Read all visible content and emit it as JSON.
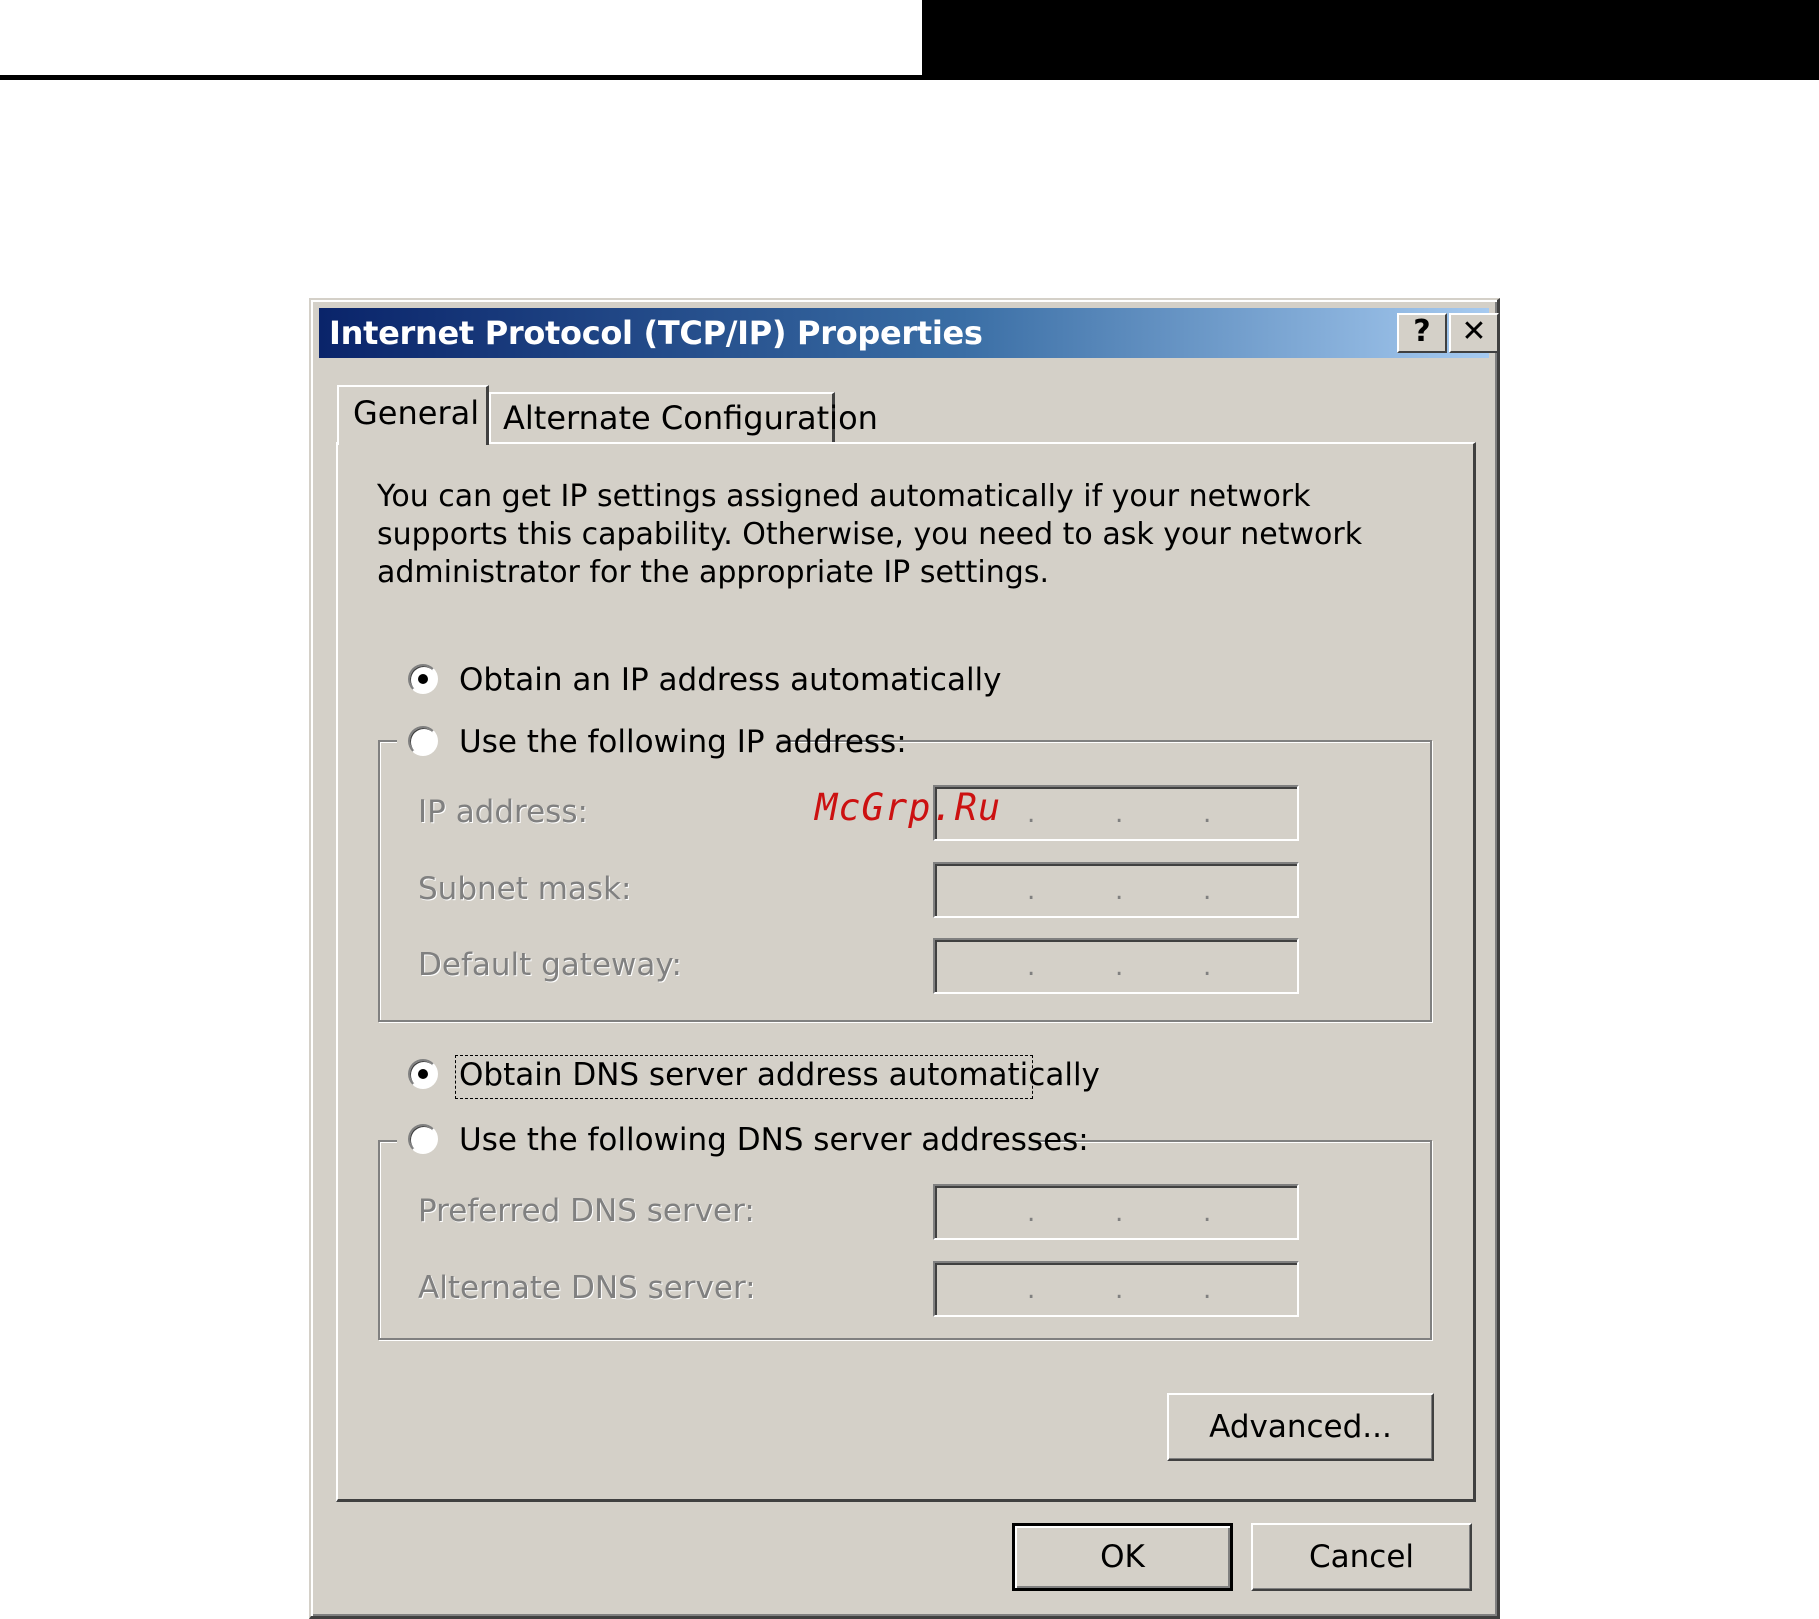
{
  "dialog": {
    "title": "Internet Protocol (TCP/IP) Properties",
    "help_button": "?",
    "close_button": "✕"
  },
  "tabs": [
    {
      "label": "General",
      "selected": true
    },
    {
      "label": "Alternate Configuration",
      "selected": false
    }
  ],
  "general": {
    "intro": "You can get IP settings assigned automatically if your network supports this capability. Otherwise, you need to ask your network administrator for the appropriate IP settings.",
    "ip_auto": {
      "label": "Obtain an IP address automatically",
      "checked": true
    },
    "ip_manual": {
      "label": "Use the following IP address:",
      "checked": false
    },
    "ip_address_label": "IP address:",
    "subnet_mask_label": "Subnet mask:",
    "default_gateway_label": "Default gateway:",
    "dns_auto": {
      "label": "Obtain DNS server address automatically",
      "checked": true
    },
    "dns_manual": {
      "label": "Use the following DNS server addresses:",
      "checked": false
    },
    "preferred_dns_label": "Preferred DNS server:",
    "alternate_dns_label": "Alternate DNS server:",
    "ip_field_dot": "."
  },
  "buttons": {
    "advanced": "Advanced...",
    "ok": "OK",
    "cancel": "Cancel"
  },
  "watermark": "McGrp.Ru"
}
